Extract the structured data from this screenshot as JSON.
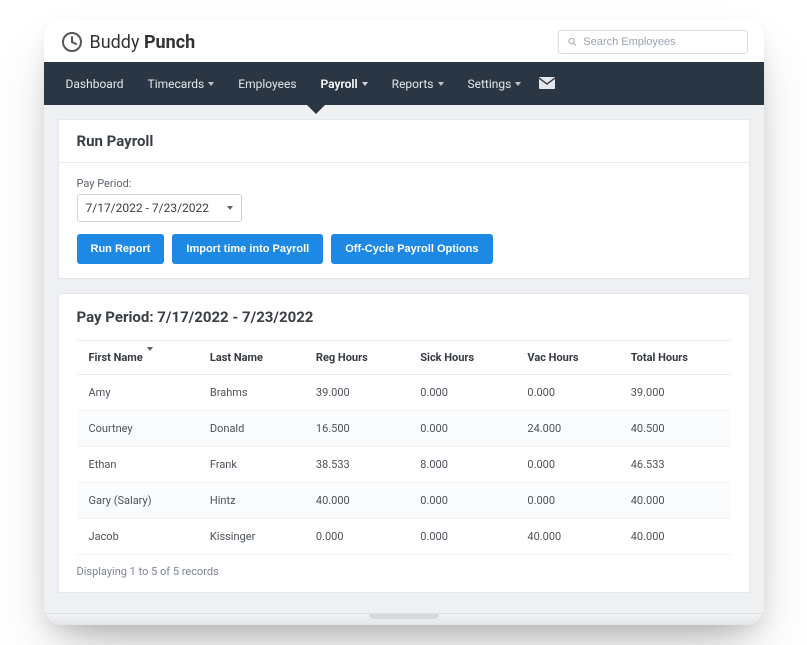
{
  "brand": {
    "name_light": "Buddy",
    "name_bold": "Punch"
  },
  "search": {
    "placeholder": "Search Employees"
  },
  "nav": {
    "items": [
      {
        "label": "Dashboard",
        "chevron": false
      },
      {
        "label": "Timecards",
        "chevron": true
      },
      {
        "label": "Employees",
        "chevron": false
      },
      {
        "label": "Payroll",
        "chevron": true,
        "active": true
      },
      {
        "label": "Reports",
        "chevron": true
      },
      {
        "label": "Settings",
        "chevron": true
      }
    ]
  },
  "run_payroll": {
    "title": "Run Payroll",
    "pay_period_label": "Pay Period:",
    "pay_period_value": "7/17/2022 - 7/23/2022",
    "buttons": {
      "run_report": "Run Report",
      "import": "Import time into Payroll",
      "off_cycle": "Off-Cycle Payroll Options"
    }
  },
  "results": {
    "title": "Pay Period: 7/17/2022 - 7/23/2022",
    "columns": [
      "First Name",
      "Last Name",
      "Reg Hours",
      "Sick Hours",
      "Vac Hours",
      "Total Hours"
    ],
    "rows": [
      {
        "first": "Amy",
        "last": "Brahms",
        "reg": "39.000",
        "sick": "0.000",
        "vac": "0.000",
        "total": "39.000"
      },
      {
        "first": "Courtney",
        "last": "Donald",
        "reg": "16.500",
        "sick": "0.000",
        "vac": "24.000",
        "total": "40.500"
      },
      {
        "first": "Ethan",
        "last": "Frank",
        "reg": "38.533",
        "sick": "8.000",
        "vac": "0.000",
        "total": "46.533"
      },
      {
        "first": "Gary (Salary)",
        "last": "Hintz",
        "reg": "40.000",
        "sick": "0.000",
        "vac": "0.000",
        "total": "40.000"
      },
      {
        "first": "Jacob",
        "last": "Kissinger",
        "reg": "0.000",
        "sick": "0.000",
        "vac": "40.000",
        "total": "40.000"
      }
    ],
    "footer": "Displaying 1 to 5 of 5 records"
  }
}
